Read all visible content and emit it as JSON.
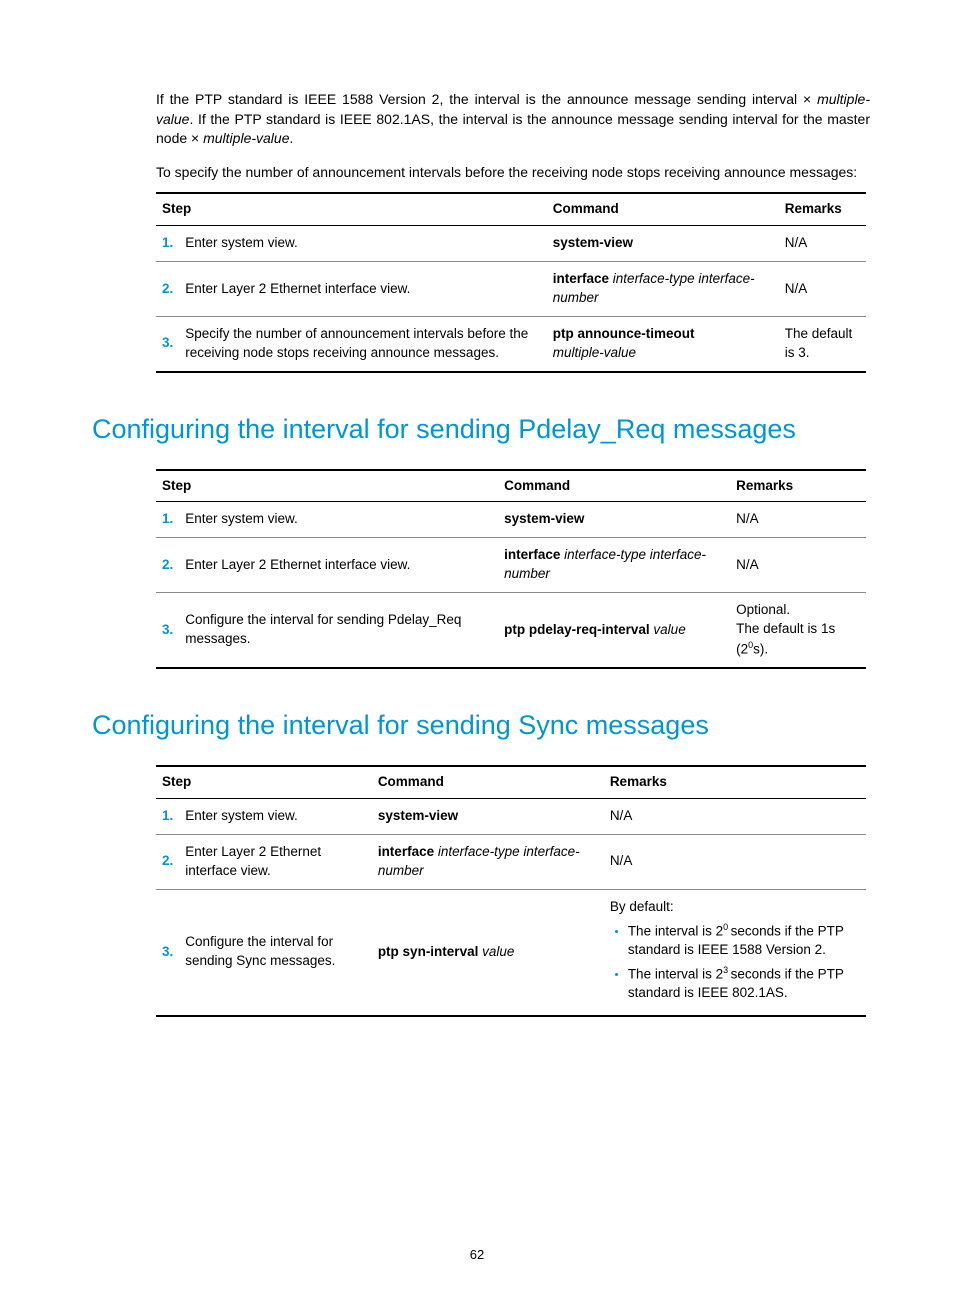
{
  "intro": {
    "p1a": "If the PTP standard is IEEE 1588 Version 2, the interval is the announce message sending interval × ",
    "p1b": "multiple-value",
    "p1c": ". If the PTP standard is IEEE 802.1AS, the interval is the announce message sending interval for the master node × ",
    "p1d": "multiple-value",
    "p1e": ".",
    "p2": "To specify the number of announcement intervals before the receiving node stops receiving announce messages:"
  },
  "headers": {
    "step": "Step",
    "command": "Command",
    "remarks": "Remarks"
  },
  "table1": {
    "rows": [
      {
        "num": "1.",
        "desc": "Enter system view.",
        "cmd_bold": "system-view",
        "rem": "N/A"
      },
      {
        "num": "2.",
        "desc": "Enter Layer 2 Ethernet interface view.",
        "cmd_bold": "interface",
        "cmd_ital": " interface-type interface-number",
        "rem": "N/A"
      },
      {
        "num": "3.",
        "desc": "Specify the number of announcement intervals before the receiving node stops receiving announce messages.",
        "cmd_bold": "ptp announce-timeout",
        "cmd_ital_nl": "multiple-value",
        "rem": "The default is 3."
      }
    ]
  },
  "heading2": "Configuring the interval for sending Pdelay_Req messages",
  "table2": {
    "rows": [
      {
        "num": "1.",
        "desc": "Enter system view.",
        "cmd_bold": "system-view",
        "rem": "N/A"
      },
      {
        "num": "2.",
        "desc": "Enter Layer 2 Ethernet interface view.",
        "cmd_bold": "interface",
        "cmd_ital": " interface-type interface-number",
        "rem": "N/A"
      },
      {
        "num": "3.",
        "desc": "Configure the interval for sending Pdelay_Req messages.",
        "cmd_bold": "ptp pdelay-req-interval",
        "cmd_ital": " value",
        "rem_line1": "Optional.",
        "rem_line2a": "The default is 1s (2",
        "rem_line2sup": "0",
        "rem_line2b": "s)."
      }
    ]
  },
  "heading3": "Configuring the interval for sending Sync messages",
  "table3": {
    "rows": [
      {
        "num": "1.",
        "desc": "Enter system view.",
        "cmd_bold": "system-view",
        "rem": "N/A"
      },
      {
        "num": "2.",
        "desc": "Enter Layer 2 Ethernet interface view.",
        "cmd_bold": "interface",
        "cmd_ital": " interface-type interface-number",
        "rem": "N/A"
      },
      {
        "num": "3.",
        "desc": "Configure the interval for sending Sync messages.",
        "cmd_bold": "ptp syn-interval",
        "cmd_ital": " value",
        "rem_header": "By default:",
        "rem_b1a": "The interval is 2",
        "rem_b1sup": "0 ",
        "rem_b1b": "seconds if the PTP standard is IEEE 1588 Version 2.",
        "rem_b2a": "The interval is 2",
        "rem_b2sup": "3 ",
        "rem_b2b": "seconds if the PTP standard is IEEE 802.1AS."
      }
    ]
  },
  "page_number": "62"
}
